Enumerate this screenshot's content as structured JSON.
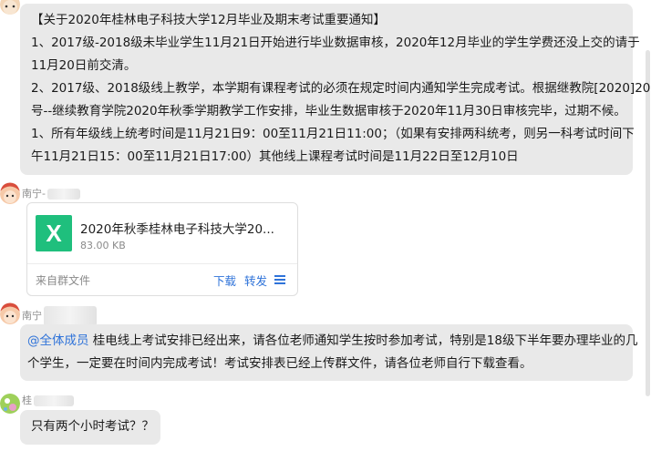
{
  "messages": {
    "notice": {
      "lines": [
        "【关于2020年桂林电子科技大学12月毕业及期末考试重要通知】",
        "1、2017级-2018级未毕业学生11月21日开始进行毕业数据审核，2020年12月毕业的学生学费还没上交的请于",
        "11月20日前交清。",
        "2、2017级、2018级线上教学，本学期有课程考试的必须在规定时间内通知学生完成考试。根据继教院[2020]20",
        "号--继续教育学院2020年秋季学期教学工作安排，毕业生数据审核于2020年11月30日审核完毕，过期不候。",
        "1、所有年级线上统考时间是11月21日9：00至11月21日11:00；（如果有安排两科统考，则另一科考试时间下",
        "午11月21日15：00至11月21日17:00）其他线上课程考试时间是11月22日至12月10日"
      ]
    },
    "file_message": {
      "sender": "南宁-",
      "file_name": "2020年秋季桂林电子科技大学20...",
      "file_size": "83.00 KB",
      "source": "来自群文件",
      "download_label": "下载",
      "forward_label": "转发",
      "icon_letter": "X"
    },
    "mention_message": {
      "sender": "南宁",
      "mention": "@全体成员",
      "line1": " 桂电线上考试安排已经出来，请各位老师通知学生按时参加考试，特别是18级下半年要办理毕业的几",
      "line2": "个学生，一定要在时间内完成考试！考试安排表已经上传群文件，请各位老师自行下载查看。"
    },
    "question_message": {
      "sender": "桂",
      "text": "只有两个小时考试？？"
    }
  },
  "colors": {
    "bubble": "#e9e9e9",
    "link": "#2f73d9",
    "excel": "#1fbf7d"
  }
}
